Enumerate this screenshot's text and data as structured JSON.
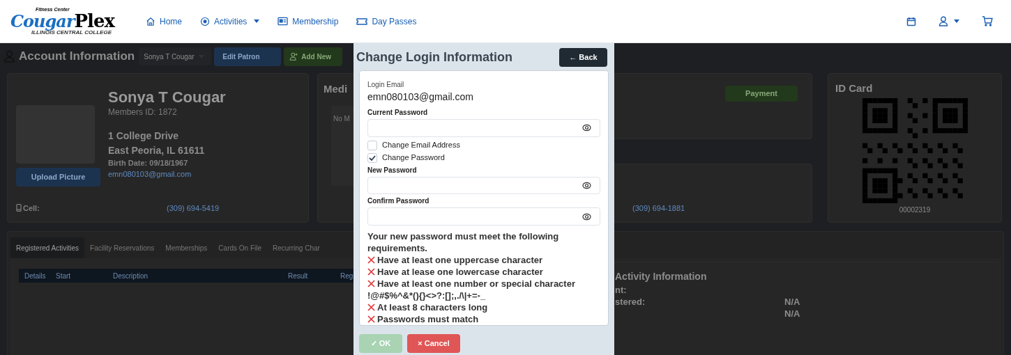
{
  "header": {
    "logo": {
      "tagline": "Fitness Center",
      "script": "Cougar",
      "bold": "Plex",
      "subtitle": "ILLINOIS CENTRAL COLLEGE"
    },
    "nav": [
      {
        "label": "Home",
        "kind": "home",
        "dropdown": false
      },
      {
        "label": "Activities",
        "kind": "ball",
        "dropdown": true
      },
      {
        "label": "Membership",
        "kind": "card",
        "dropdown": false
      },
      {
        "label": "Day Passes",
        "kind": "ticket",
        "dropdown": false
      }
    ],
    "actions": [
      {
        "kind": "calendar",
        "dropdown": false
      },
      {
        "kind": "user",
        "dropdown": true
      },
      {
        "kind": "cart",
        "dropdown": false
      }
    ]
  },
  "account": {
    "title": "Account Information",
    "patron_select": "Sonya T Cougar",
    "buttons": [
      {
        "label": "Edit Patron",
        "kind": "edit"
      },
      {
        "label": "Add New",
        "kind": "add"
      }
    ]
  },
  "profile": {
    "name": "Sonya T Cougar",
    "member_id": "Members ID: 1872",
    "address_line1": "1 College Drive",
    "address_line2": "East Peoria, IL 61611",
    "birth_date": "Birth Date: 09/18/1967",
    "email": "emn080103@gmail.com",
    "upload_button": "Upload Picture",
    "cell_label": "Cell:",
    "cell_phone": "(309) 694-5419"
  },
  "medical": {
    "title": "Medi",
    "note": "No M"
  },
  "billing": {
    "payment_button": "Payment"
  },
  "contact": {
    "phone": "(309) 694-1881"
  },
  "id_card": {
    "title": "ID Card",
    "number": "00002319"
  },
  "tabs": [
    {
      "label": "Registered Activities",
      "selected": true
    },
    {
      "label": "Facility Reservations",
      "selected": false
    },
    {
      "label": "Memberships",
      "selected": false
    },
    {
      "label": "Cards On File",
      "selected": false
    },
    {
      "label": "Recurring Char",
      "selected": false
    }
  ],
  "table": {
    "columns": [
      "Details",
      "Start",
      "Description",
      "Result",
      "Reg"
    ]
  },
  "activity_info": {
    "title": "Activity Information",
    "rows": [
      {
        "label": "nt:"
      },
      {
        "label": "stered:",
        "value": "N/A"
      },
      {
        "value": "N/A"
      }
    ]
  },
  "dialog": {
    "title": "Change Login Information",
    "back_button": "← Back",
    "email_label": "Login Email",
    "email": "emn080103@gmail.com",
    "fields_before": [
      {
        "label": "Current Password"
      }
    ],
    "options": [
      {
        "label": "Change Email Address",
        "checked": false
      },
      {
        "label": "Change Password",
        "checked": true
      }
    ],
    "fields_after": [
      {
        "label": "New Password"
      },
      {
        "label": "Confirm Password"
      }
    ],
    "requirements_intro": "Your new password must meet the following requirements.",
    "requirements": [
      {
        "text": "Have at least one uppercase character",
        "met": false
      },
      {
        "text": "Have at lease one lowercase character",
        "met": false
      },
      {
        "text": "Have at least one number or special character !@#$%^&*(){}<>?:[];,./\\|+=-_",
        "met": false
      },
      {
        "text": "At least 8 characters long",
        "met": false
      },
      {
        "text": "Passwords must match",
        "met": false
      }
    ],
    "ok_button": {
      "label": "✓ OK",
      "disabled": true
    },
    "cancel_button": "× Cancel"
  }
}
